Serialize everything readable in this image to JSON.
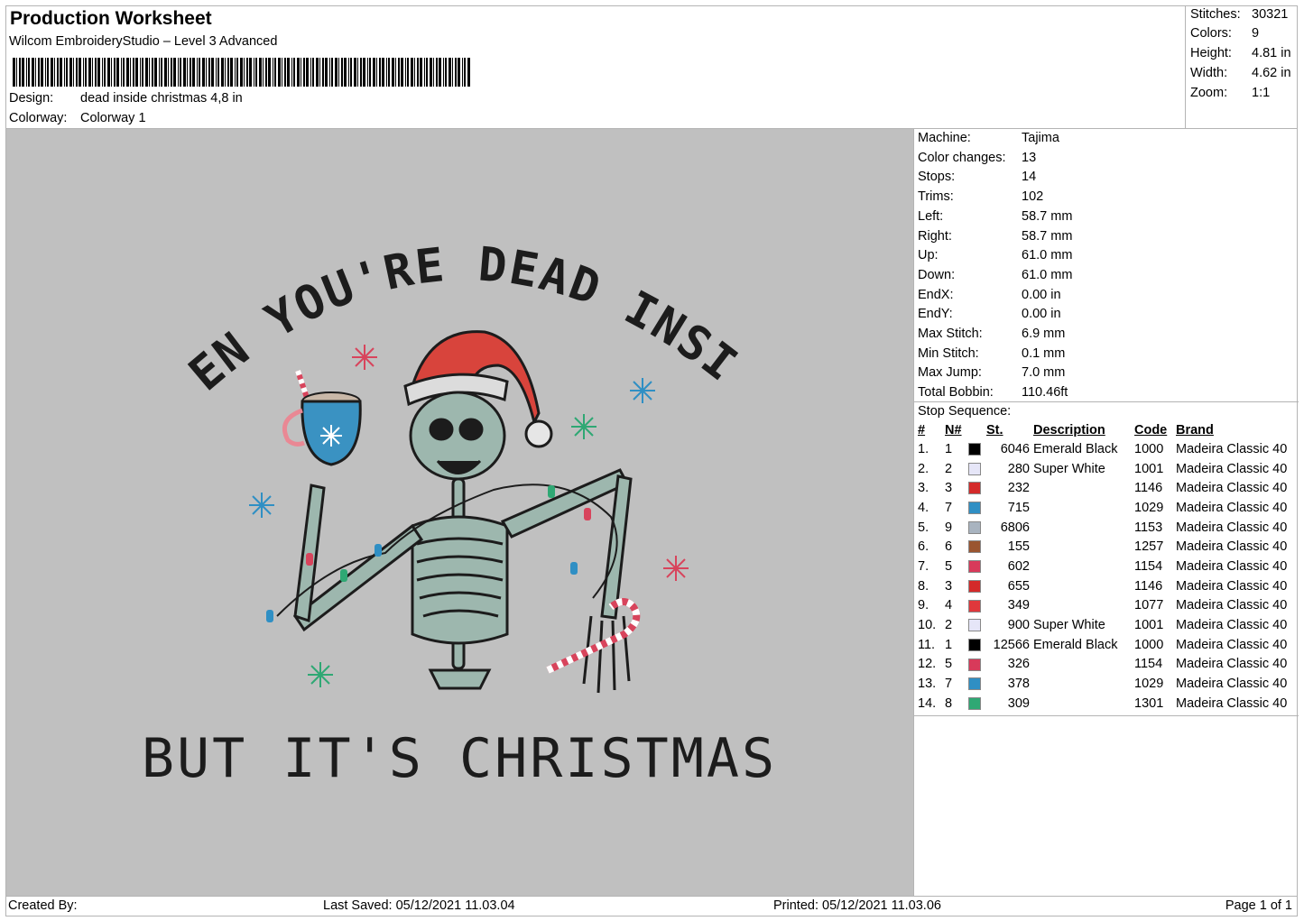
{
  "header": {
    "title": "Production Worksheet",
    "software": "Wilcom EmbroideryStudio – Level 3 Advanced",
    "design_label": "Design:",
    "design_value": "dead inside christmas 4,8 in",
    "colorway_label": "Colorway:",
    "colorway_value": "Colorway 1"
  },
  "summary": [
    {
      "label": "Stitches:",
      "value": "30321"
    },
    {
      "label": "Colors:",
      "value": "9"
    },
    {
      "label": "Height:",
      "value": "4.81 in"
    },
    {
      "label": "Width:",
      "value": "4.62 in"
    },
    {
      "label": "Zoom:",
      "value": "1:1"
    }
  ],
  "machine_info": [
    {
      "label": "Machine:",
      "value": "Tajima"
    },
    {
      "label": "Color changes:",
      "value": "13"
    },
    {
      "label": "Stops:",
      "value": "14"
    },
    {
      "label": "Trims:",
      "value": "102"
    },
    {
      "label": "Left:",
      "value": "58.7 mm"
    },
    {
      "label": "Right:",
      "value": "58.7 mm"
    },
    {
      "label": "Up:",
      "value": "61.0 mm"
    },
    {
      "label": "Down:",
      "value": "61.0 mm"
    },
    {
      "label": "EndX:",
      "value": "0.00 in"
    },
    {
      "label": "EndY:",
      "value": "0.00 in"
    },
    {
      "label": "Max Stitch:",
      "value": "6.9 mm"
    },
    {
      "label": "Min Stitch:",
      "value": "0.1 mm"
    },
    {
      "label": "Max Jump:",
      "value": "7.0 mm"
    },
    {
      "label": "Total Bobbin:",
      "value": "110.46ft"
    }
  ],
  "stop_sequence": {
    "title": "Stop Sequence:",
    "headers": {
      "idx": "#",
      "n": "N#",
      "st": "St.",
      "desc": "Description",
      "code": "Code",
      "brand": "Brand"
    },
    "rows": [
      {
        "idx": "1.",
        "n": "1",
        "color": "#000000",
        "st": "6046",
        "desc": "Emerald Black",
        "code": "1000",
        "brand": "Madeira Classic 40"
      },
      {
        "idx": "2.",
        "n": "2",
        "color": "#e6e6f8",
        "st": "280",
        "desc": "Super White",
        "code": "1001",
        "brand": "Madeira Classic 40"
      },
      {
        "idx": "3.",
        "n": "3",
        "color": "#d42a2a",
        "st": "232",
        "desc": "",
        "code": "1146",
        "brand": "Madeira Classic 40"
      },
      {
        "idx": "4.",
        "n": "7",
        "color": "#2f8fc4",
        "st": "715",
        "desc": "",
        "code": "1029",
        "brand": "Madeira Classic 40"
      },
      {
        "idx": "5.",
        "n": "9",
        "color": "#a9b4c0",
        "st": "6806",
        "desc": "",
        "code": "1153",
        "brand": "Madeira Classic 40"
      },
      {
        "idx": "6.",
        "n": "6",
        "color": "#9a5530",
        "st": "155",
        "desc": "",
        "code": "1257",
        "brand": "Madeira Classic 40"
      },
      {
        "idx": "7.",
        "n": "5",
        "color": "#d83a5a",
        "st": "602",
        "desc": "",
        "code": "1154",
        "brand": "Madeira Classic 40"
      },
      {
        "idx": "8.",
        "n": "3",
        "color": "#d42a2a",
        "st": "655",
        "desc": "",
        "code": "1146",
        "brand": "Madeira Classic 40"
      },
      {
        "idx": "9.",
        "n": "4",
        "color": "#e0383c",
        "st": "349",
        "desc": "",
        "code": "1077",
        "brand": "Madeira Classic 40"
      },
      {
        "idx": "10.",
        "n": "2",
        "color": "#e6e6f8",
        "st": "900",
        "desc": "Super White",
        "code": "1001",
        "brand": "Madeira Classic 40"
      },
      {
        "idx": "11.",
        "n": "1",
        "color": "#000000",
        "st": "12566",
        "desc": "Emerald Black",
        "code": "1000",
        "brand": "Madeira Classic 40"
      },
      {
        "idx": "12.",
        "n": "5",
        "color": "#d83a5a",
        "st": "326",
        "desc": "",
        "code": "1154",
        "brand": "Madeira Classic 40"
      },
      {
        "idx": "13.",
        "n": "7",
        "color": "#2f8fc4",
        "st": "378",
        "desc": "",
        "code": "1029",
        "brand": "Madeira Classic 40"
      },
      {
        "idx": "14.",
        "n": "8",
        "color": "#2fa874",
        "st": "309",
        "desc": "",
        "code": "1301",
        "brand": "Madeira Classic 40"
      }
    ]
  },
  "design_text": {
    "top": "WHEN YOU'RE DEAD INSIDE",
    "bottom": "BUT IT'S CHRISTMAS"
  },
  "footer": {
    "created_by": "Created By:",
    "last_saved": "Last Saved: 05/12/2021 11.03.04",
    "printed": "Printed: 05/12/2021 11.03.06",
    "page": "Page 1 of 1"
  }
}
